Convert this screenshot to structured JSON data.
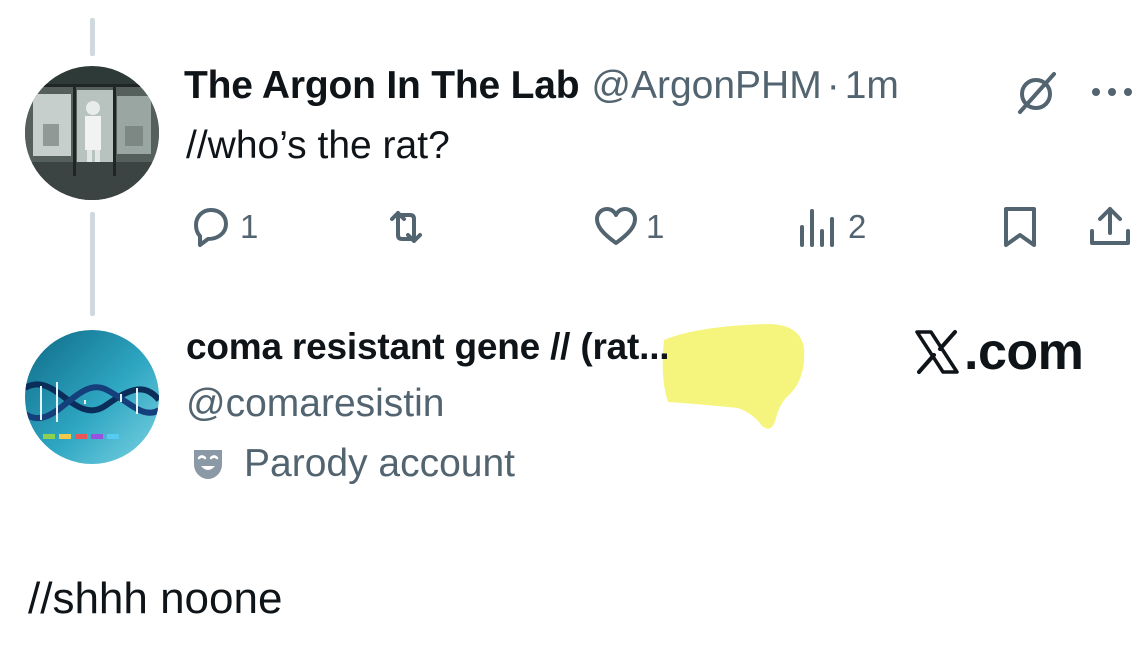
{
  "parent_tweet": {
    "display_name": "The Argon In The Lab",
    "handle": "@ArgonPHM",
    "separator": "·",
    "timestamp": "1m",
    "text": "//who’s the rat?",
    "actions": {
      "reply_count": "1",
      "retweet_count": "",
      "like_count": "1",
      "views_count": "2"
    },
    "avatar_icon": "lab-photo-avatar"
  },
  "reply_account": {
    "display_name": "coma resistant gene // (rat...",
    "handle": "@comaresistin",
    "badge_label": "Parody account",
    "badge_icon": "theater-mask-icon",
    "avatar_icon": "dna-helix-avatar"
  },
  "watermark": {
    "text": ".com",
    "icon": "x-logo-icon"
  },
  "reply_text": "//shhh noone",
  "colors": {
    "primary_text": "#0f1419",
    "secondary_text": "#536471",
    "thread_line": "#cfd9de",
    "highlight": "#f4f36e"
  }
}
